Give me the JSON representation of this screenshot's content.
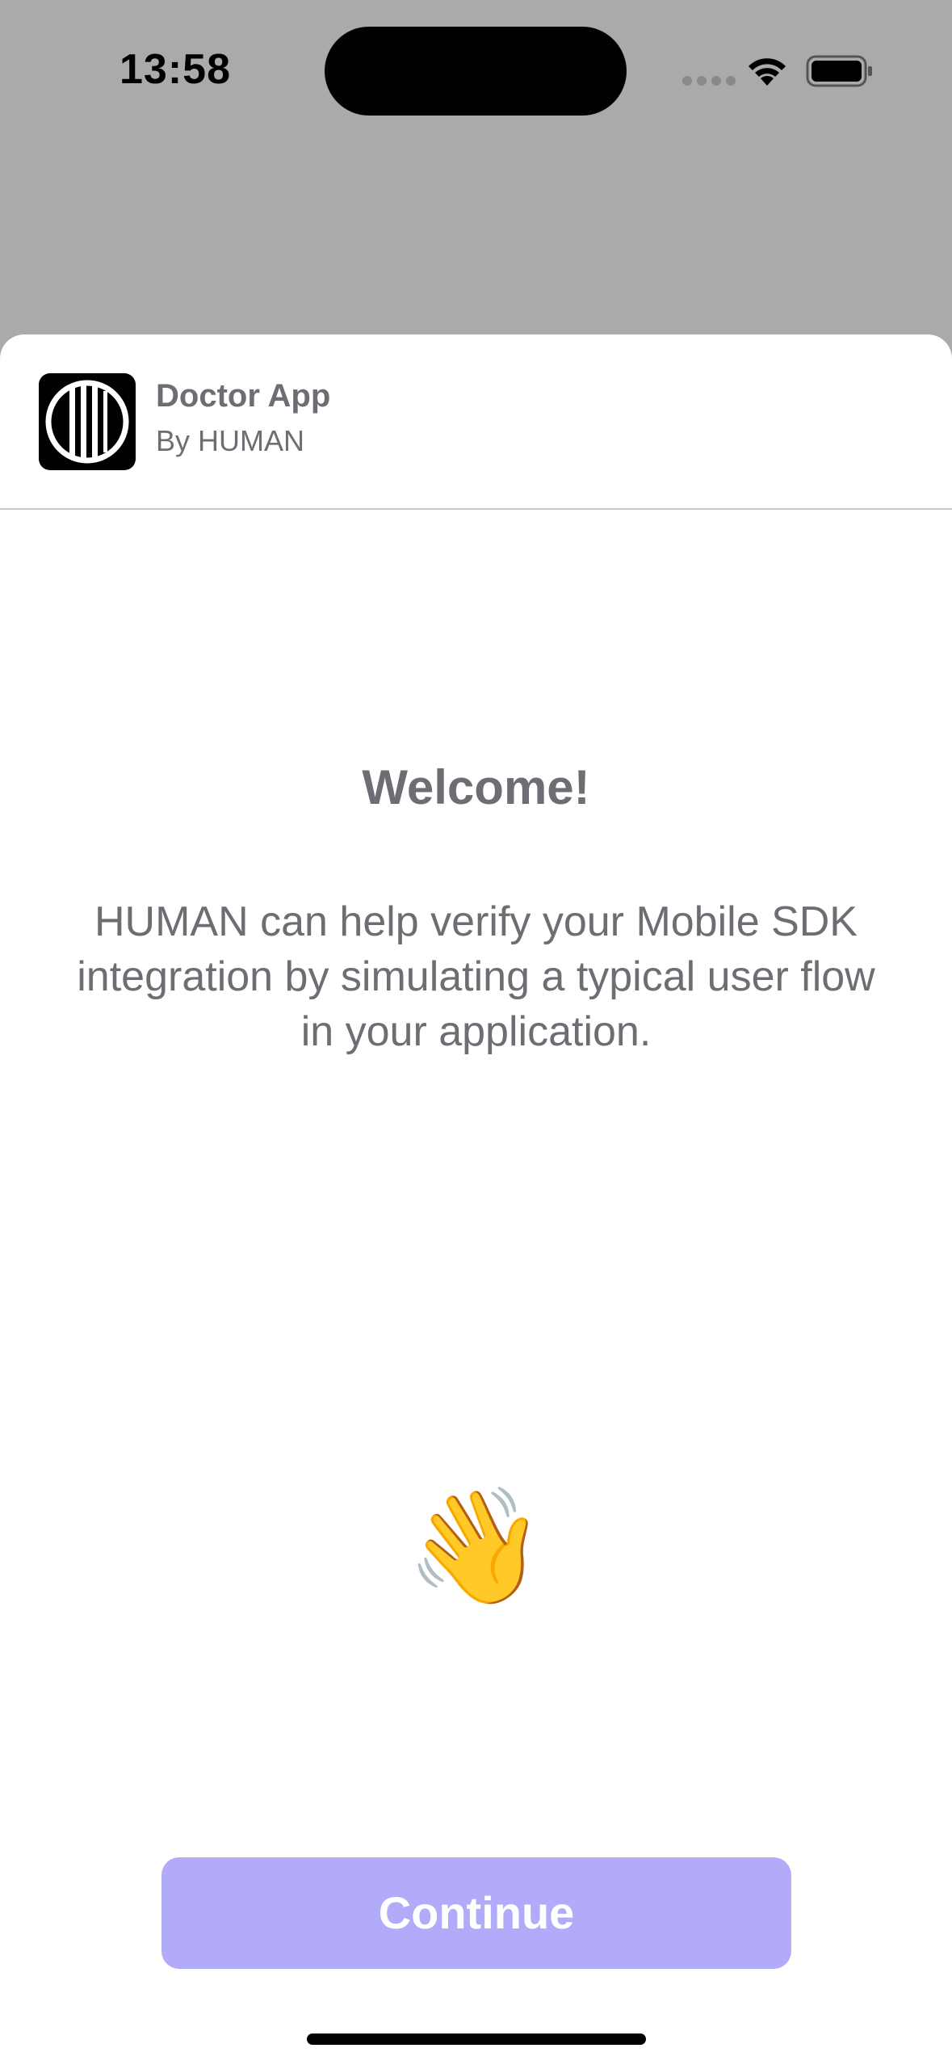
{
  "status_bar": {
    "time": "13:58",
    "wifi_icon": "wifi-icon",
    "battery_icon": "battery-icon"
  },
  "app_header": {
    "name": "Doctor App",
    "by": "By HUMAN",
    "logo_icon": "app-logo-icon"
  },
  "main": {
    "title": "Welcome!",
    "body": "HUMAN can help verify your Mobile SDK integration by simulating a typical user flow in your application.",
    "wave_emoji": "👋"
  },
  "actions": {
    "continue_label": "Continue"
  },
  "colors": {
    "overlay": "#aaaaaa",
    "sheet": "#ffffff",
    "text_secondary": "#6d6d74",
    "button_disabled": "#b2abfa",
    "button_text": "#ffffff"
  }
}
